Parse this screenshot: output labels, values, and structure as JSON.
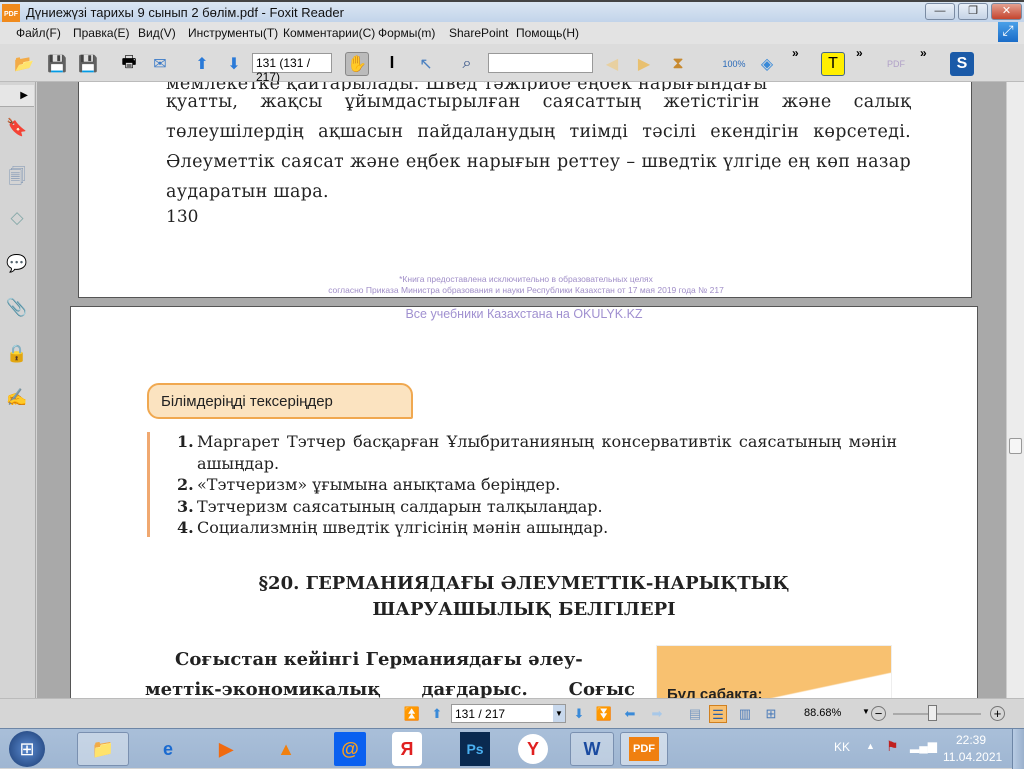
{
  "window": {
    "title": "Дүниежүзі тарихы 9 сынып 2 бөлім.pdf - Foxit Reader",
    "logo_text": "PDF",
    "minimize": "—",
    "restore": "❐",
    "close": "✕"
  },
  "menu": [
    "Файл(F)",
    "Правка(E)",
    "Вид(V)",
    "Инструменты(T)",
    "Комментарии(C)",
    "Формы(m)",
    "SharePoint",
    "Помощь(H)"
  ],
  "toolbar": {
    "page_field": "131 (131 / 217)",
    "search_value": "",
    "overflow": "»"
  },
  "sidebar": {
    "icons": [
      "bookmark-icon",
      "pages-icon",
      "layers-icon",
      "comments-icon",
      "attachment-icon",
      "security-icon",
      "signature-icon"
    ]
  },
  "page1": {
    "cut_line": "мемлекетке қайтарылады. Швед тәжірибе еңбек нарығындағы",
    "lines": "қуатты, жақсы ұйымдастырылған саясаттың жетістігін және салық төлеушілердің ақшасын пайдаланудың тиімді тәсілі екендігін көрсетеді. Әлеуметтік саясат және еңбек нарығын реттеу – шведтік үлгіде ең көп назар аударатын шара.",
    "page_number": "130",
    "notice1": "*Книга предоставлена исключительно в образовательных целях",
    "notice2": "согласно Приказа Министра образования и науки Республики Казахстан от 17 мая 2019 года № 217"
  },
  "page2": {
    "watermark": "Все учебники Казахстана на OKULYK.KZ",
    "box_title": "Білімдеріңді тексеріңдер",
    "questions": [
      {
        "num": "1.",
        "text": "Маргарет Тэтчер басқарған Ұлыбританияның консервативтік саясатының мәнін ашыңдар."
      },
      {
        "num": "2.",
        "text": "«Тэтчеризм» ұғымына анықтама беріңдер."
      },
      {
        "num": "3.",
        "text": "Тэтчеризм саясатының салдарын талқылаңдар."
      },
      {
        "num": "4.",
        "text": "Социализмнің шведтік үлгісінің мәнін ашыңдар."
      }
    ],
    "heading1": "§20. ГЕРМАНИЯДАҒЫ ӘЛЕУМЕТТІК-НАРЫҚТЫҚ",
    "heading2": "ШАРУАШЫЛЫҚ БЕЛГІЛЕРІ",
    "para1": "Соғыстан кейінгі Германиядағы әлеу-",
    "para2": "меттік-экономикалық дағдарыс. Соғыс",
    "side_box": "Бүл сабақта:"
  },
  "statusbar": {
    "page_select": "131 / 217",
    "zoom": "88.68%"
  },
  "taskbar": {
    "lang": "KK",
    "time": "22:39",
    "date": "11.04.2021",
    "apps": [
      "explorer",
      "internet-explorer",
      "media-player",
      "vlc",
      "mail",
      "yandex",
      "photoshop",
      "yandex-browser",
      "word",
      "foxit-reader"
    ],
    "ps": "Ps",
    "word": "W",
    "pdf": "PDF",
    "yandex": "Я",
    "ybrowser": "Y",
    "mail": "@"
  },
  "colors": {
    "accent_orange": "#f08a1c",
    "box_bg": "#fbe3c0",
    "box_border": "#f0a850"
  }
}
